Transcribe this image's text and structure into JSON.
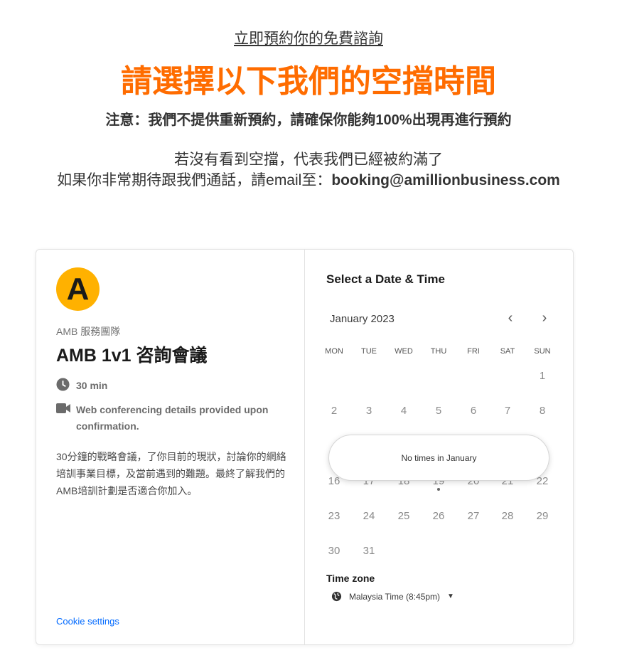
{
  "header": {
    "subheading": "立即預約你的免費諮詢",
    "title": "請選擇以下我們的空擋時間",
    "notice": "注意：我們不提供重新預約，請確保你能夠100%出現再進行預約",
    "line1": "若沒有看到空擋，代表我們已經被約滿了",
    "line2_prefix": "如果你非常期待跟我們通話，請email至：",
    "email": "booking@amillionbusiness.com"
  },
  "event": {
    "avatar_letter": "A",
    "avatar_color": "#ffb100",
    "organizer": "AMB 服務團隊",
    "name": "AMB 1v1 咨詢會議",
    "duration": "30 min",
    "conferencing": "Web conferencing details provided upon confirmation.",
    "description": "30分鐘的戰略會議，了你目前的現狀，討論你的網絡培訓事業目標，及當前遇到的難題。最終了解我們的AMB培訓計劃是否適合你加入。",
    "cookie_settings": "Cookie settings"
  },
  "calendar": {
    "heading": "Select a Date & Time",
    "month": "January 2023",
    "prev_icon": "chevron-left-icon",
    "next_icon": "chevron-right-icon",
    "weekdays": [
      "MON",
      "TUE",
      "WED",
      "THU",
      "FRI",
      "SAT",
      "SUN"
    ],
    "days_in_month": 31,
    "first_weekday_index": 6,
    "hidden_week_index": 2,
    "today": 19,
    "popup": "No times in January",
    "timezone_label": "Time zone",
    "timezone": "Malaysia Time (8:45pm)"
  },
  "colors": {
    "accent": "#ff6c00",
    "link": "#0069ff"
  }
}
